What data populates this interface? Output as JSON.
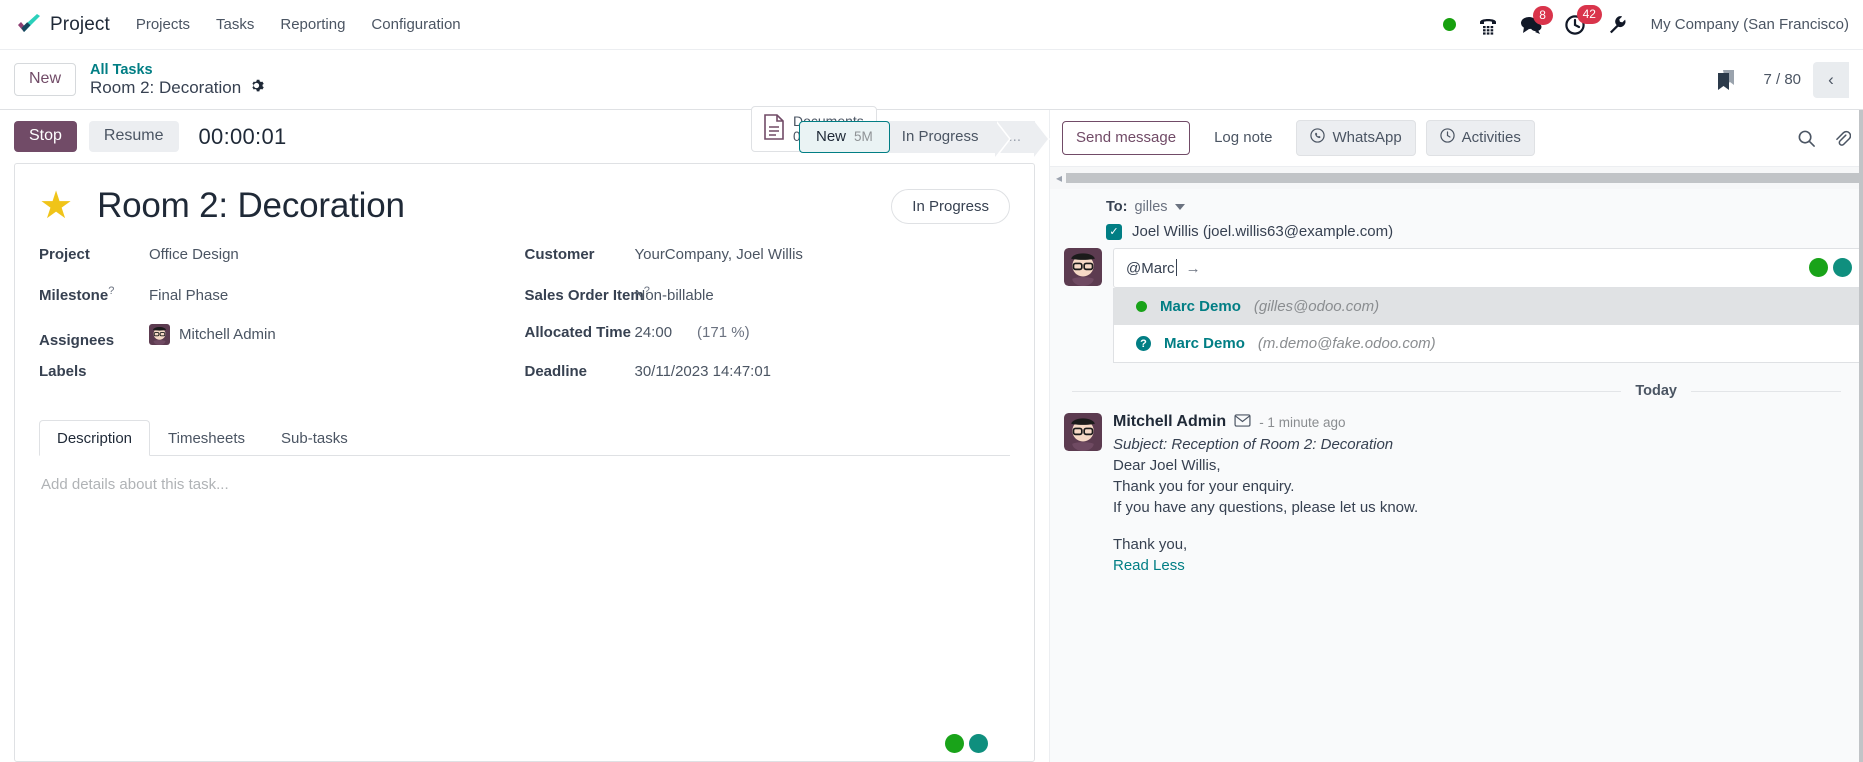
{
  "navbar": {
    "app_name": "Project",
    "menu": [
      {
        "label": "Projects"
      },
      {
        "label": "Tasks"
      },
      {
        "label": "Reporting"
      },
      {
        "label": "Configuration"
      }
    ],
    "systray": {
      "presence": "online-dot",
      "phone_icon": "phone-dialpad-icon",
      "messages_icon": "chat-bubble-icon",
      "messages_count": "8",
      "activities_icon": "clock-icon",
      "activities_count": "42",
      "settings_icon": "wrench-icon"
    },
    "company": "My Company (San Francisco)"
  },
  "control_panel": {
    "new_label": "New",
    "breadcrumb_parent": "All Tasks",
    "breadcrumb_current": "Room 2: Decoration",
    "gear_icon": "gear-icon",
    "documents": {
      "label": "Documents",
      "count": "0",
      "icon": "document-icon"
    },
    "bookmark_icon": "bookmark-icon",
    "pager": "7 / 80",
    "pager_prev_icon": "chevron-left-icon"
  },
  "timer": {
    "stop_label": "Stop",
    "resume_label": "Resume",
    "elapsed": "00:00:01"
  },
  "statusbar": {
    "stages": [
      {
        "label": "New",
        "sub": "5M",
        "state": "active"
      },
      {
        "label": "In Progress",
        "sub": "",
        "state": "normal"
      },
      {
        "label": "...",
        "sub": "",
        "state": "dots"
      }
    ]
  },
  "form": {
    "priority_icon": "star-icon",
    "title": "Room 2: Decoration",
    "kanban_state": "In Progress",
    "left_fields": [
      {
        "label": "Project",
        "tip": "",
        "value": "Office Design"
      },
      {
        "label": "Milestone",
        "tip": "?",
        "value": "Final Phase"
      },
      {
        "label": "Assignees",
        "tip": "",
        "value": "Mitchell Admin",
        "avatar": "user-avatar"
      },
      {
        "label": "Labels",
        "tip": "",
        "value": ""
      }
    ],
    "right_fields": [
      {
        "label": "Customer",
        "tip": "",
        "value": "YourCompany, Joel Willis"
      },
      {
        "label": "Sales Order Item",
        "tip": "?",
        "value": "Non-billable"
      },
      {
        "label": "Allocated Time",
        "tip": "",
        "value": "24:00",
        "extra": "(171 %)"
      },
      {
        "label": "Deadline",
        "tip": "",
        "value": "30/11/2023 14:47:01"
      }
    ],
    "tabs": [
      {
        "label": "Description",
        "active": true
      },
      {
        "label": "Timesheets",
        "active": false
      },
      {
        "label": "Sub-tasks",
        "active": false
      }
    ],
    "description_placeholder": "Add details about this task..."
  },
  "chatter": {
    "buttons": [
      {
        "label": "Send message",
        "style": "primary",
        "icon": ""
      },
      {
        "label": "Log note",
        "style": "plain",
        "icon": ""
      },
      {
        "label": "WhatsApp",
        "style": "grey",
        "icon": "whatsapp-icon"
      },
      {
        "label": "Activities",
        "style": "grey",
        "icon": "clock-icon"
      }
    ],
    "search_icon": "search-icon",
    "attachment_icon": "paperclip-icon",
    "recipients": {
      "to_label": "To:",
      "to_value": "gilles",
      "follower": "Joel Willis (joel.willis63@example.com)",
      "checked": true
    },
    "composer": {
      "value": "@Marc",
      "send_arrow_icon": "arrow-right-icon",
      "avatar": "user-avatar"
    },
    "suggestions": [
      {
        "name": "Marc Demo",
        "email": "(gilles@odoo.com)",
        "marker": "online-dot",
        "highlighted": true
      },
      {
        "name": "Marc Demo",
        "email": "(m.demo@fake.odoo.com)",
        "marker": "question-badge",
        "highlighted": false
      }
    ],
    "date_separator": "Today",
    "message": {
      "author": "Mitchell Admin",
      "channel_icon": "envelope-icon",
      "timestamp": "- 1 minute ago",
      "subject": "Subject: Reception of Room 2: Decoration",
      "lines": [
        "Dear Joel Willis,",
        "Thank you for your enquiry.",
        "If you have any questions, please let us know."
      ],
      "signoff": "Thank you,",
      "read_less": "Read Less"
    }
  }
}
